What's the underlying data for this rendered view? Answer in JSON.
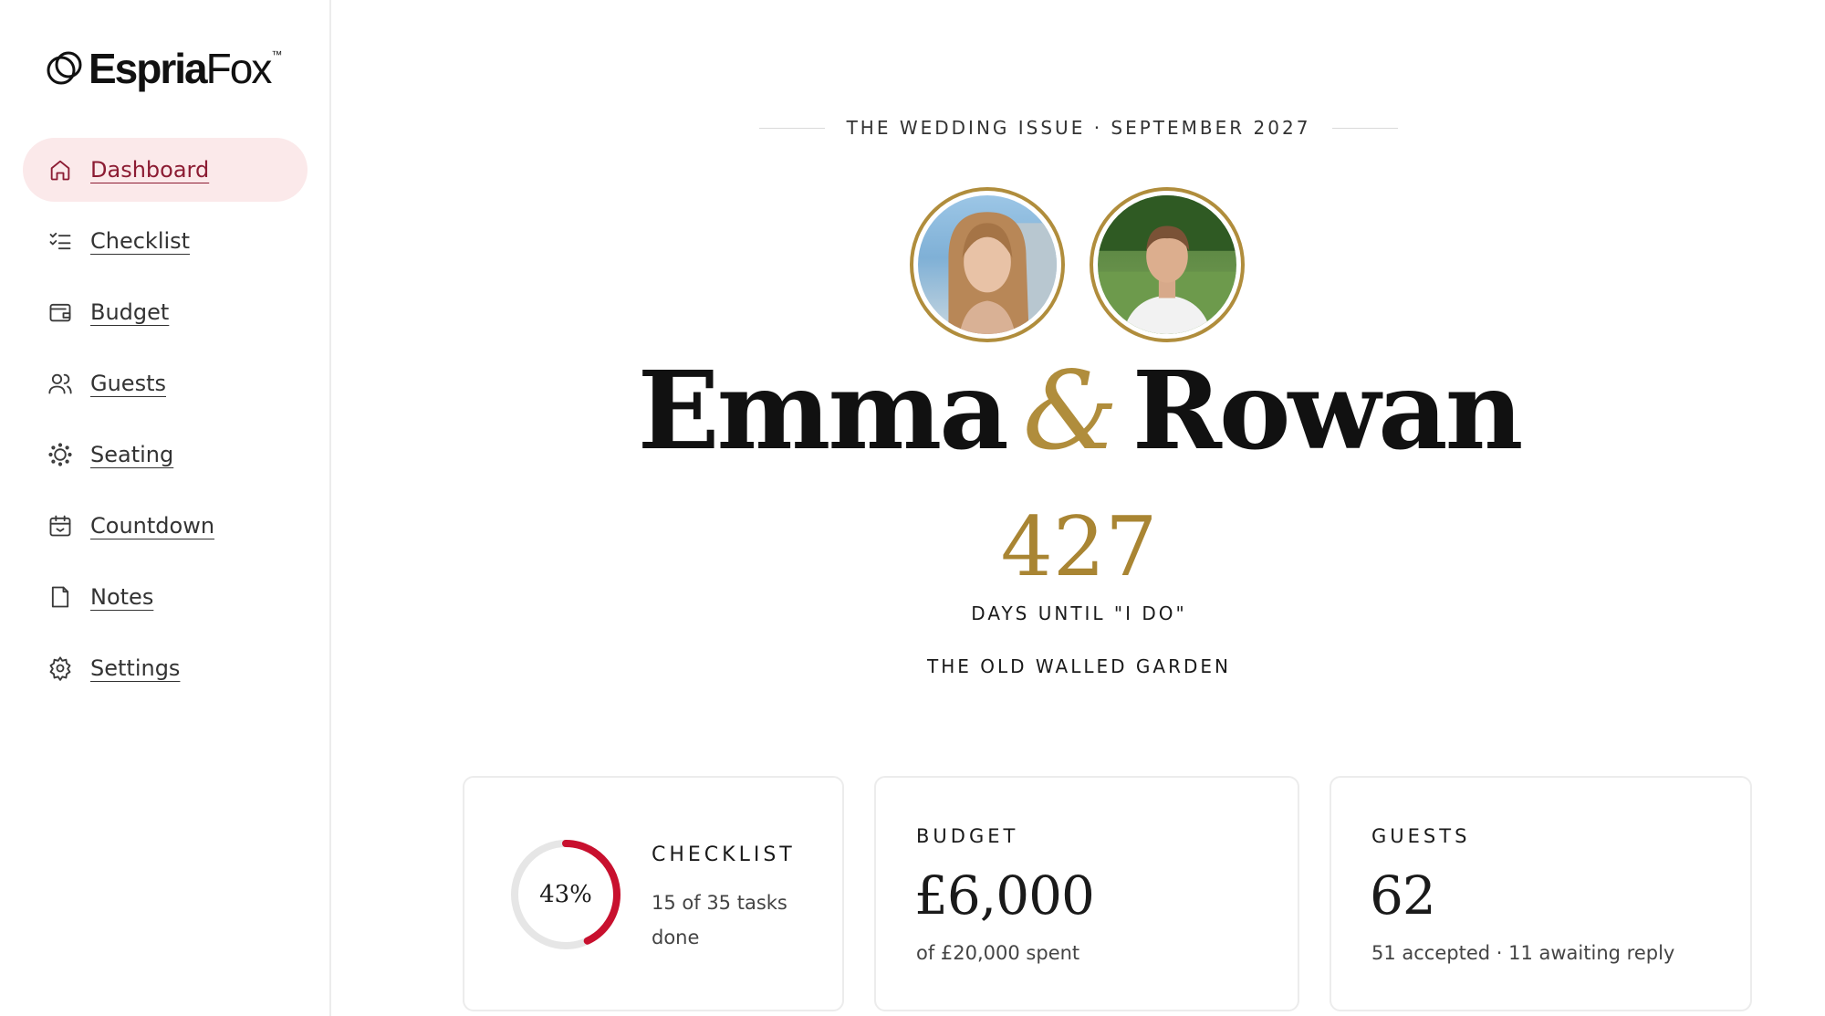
{
  "brand": {
    "name_bold": "Espria",
    "name_light": "Fox",
    "trademark": "™"
  },
  "sidebar": {
    "items": [
      {
        "label": "Dashboard",
        "icon": "home-icon",
        "active": true
      },
      {
        "label": "Checklist",
        "icon": "checklist-icon",
        "active": false
      },
      {
        "label": "Budget",
        "icon": "wallet-icon",
        "active": false
      },
      {
        "label": "Guests",
        "icon": "users-icon",
        "active": false
      },
      {
        "label": "Seating",
        "icon": "seating-icon",
        "active": false
      },
      {
        "label": "Countdown",
        "icon": "calendar-icon",
        "active": false
      },
      {
        "label": "Notes",
        "icon": "note-icon",
        "active": false
      },
      {
        "label": "Settings",
        "icon": "gear-icon",
        "active": false
      }
    ]
  },
  "hero": {
    "issue": "THE WEDDING ISSUE · SEPTEMBER 2027",
    "partner1": "Emma",
    "ampersand": "&",
    "partner2": "Rowan",
    "days": "427",
    "days_label": "DAYS UNTIL \"I DO\"",
    "venue": "THE OLD WALLED GARDEN"
  },
  "cards": {
    "checklist": {
      "title": "CHECKLIST",
      "percent_label": "43%",
      "progress": 0.43,
      "subtitle": "15 of 35 tasks done"
    },
    "budget": {
      "title": "BUDGET",
      "value": "£6,000",
      "note": "of £20,000 spent"
    },
    "guests": {
      "title": "GUESTS",
      "value": "62",
      "note": "51 accepted · 11 awaiting reply"
    }
  },
  "colors": {
    "accent": "#8c1c33",
    "gold": "#b08d3c",
    "ring": "#c8102e",
    "active_bg": "#fbe9ea"
  }
}
